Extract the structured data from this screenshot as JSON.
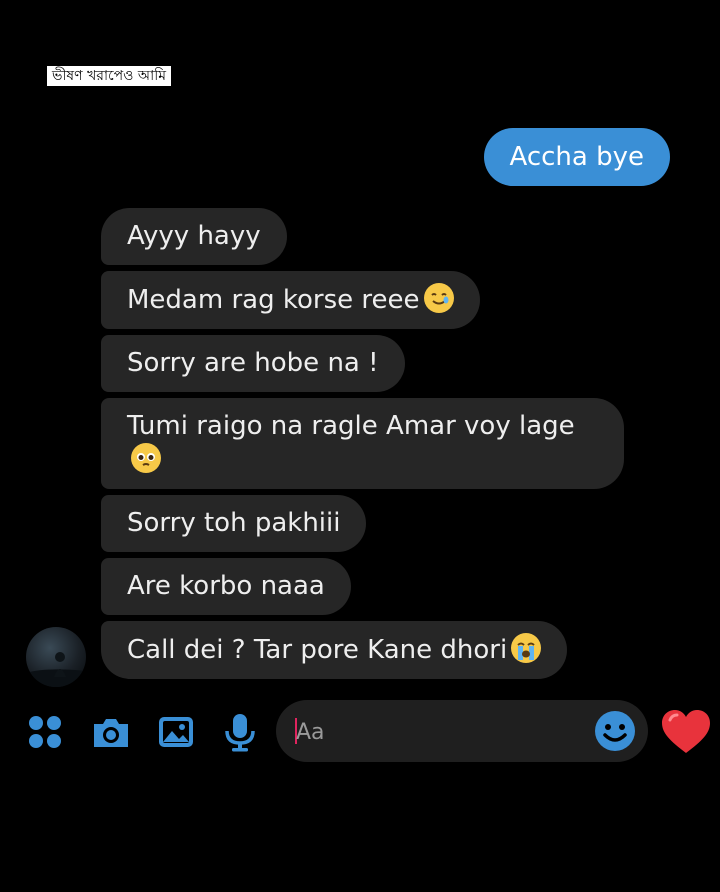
{
  "caption": "ভীষণ খরাপেও আমি",
  "conversation": {
    "sent_message": "Accha bye",
    "received_messages": [
      {
        "text": "Ayyy hayy",
        "emoji": ""
      },
      {
        "text": "Medam rag korse reee",
        "emoji": "smiling-face-with-tear"
      },
      {
        "text": "Sorry are hobe na !",
        "emoji": ""
      },
      {
        "text": "Tumi raigo na ragle Amar voy lage",
        "emoji": "pleading-face"
      },
      {
        "text": "Sorry toh pakhiii",
        "emoji": ""
      },
      {
        "text": "Are korbo naaa",
        "emoji": ""
      },
      {
        "text": "Call dei ? Tar pore Kane dhori",
        "emoji": "loudly-crying-face"
      }
    ]
  },
  "composer": {
    "placeholder": "Aa",
    "value": ""
  },
  "toolbar": {
    "icons": [
      "apps-icon",
      "camera-icon",
      "gallery-icon",
      "microphone-icon",
      "emoji-icon",
      "heart-icon"
    ]
  },
  "colors": {
    "background": "#000000",
    "sent_bubble": "#3a8fd6",
    "received_bubble": "#262626",
    "accent": "#3a8fd6",
    "heart": "#e8333c"
  }
}
